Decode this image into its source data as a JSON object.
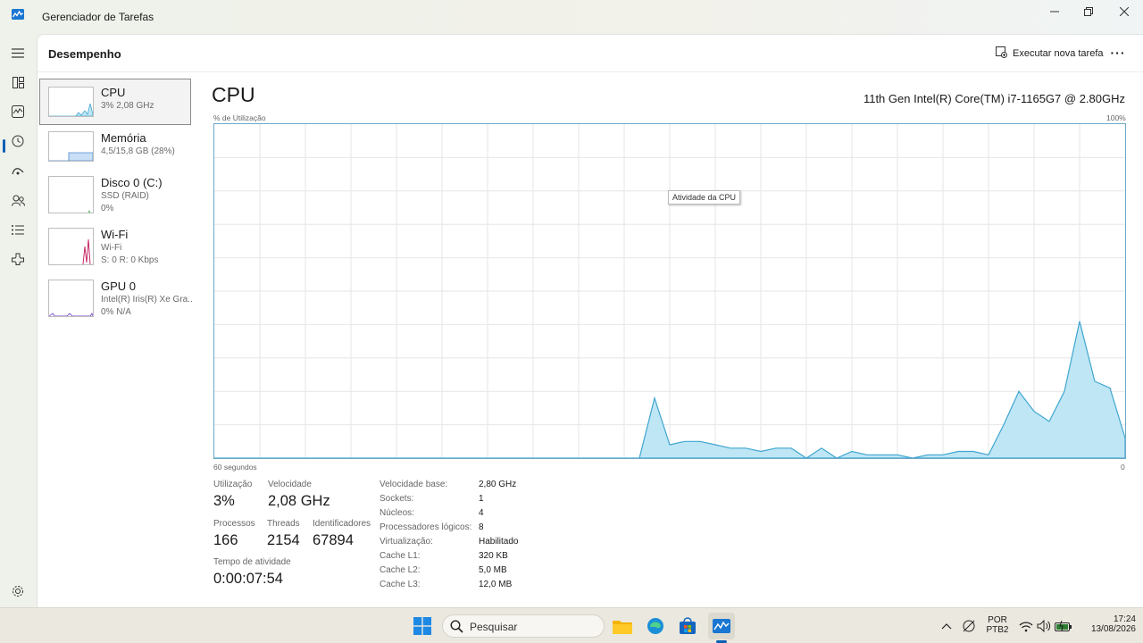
{
  "window": {
    "title": "Gerenciador de Tarefas"
  },
  "header": {
    "section_title": "Desempenho",
    "run_task_label": "Executar nova tarefa",
    "more_label": "···"
  },
  "devices": [
    {
      "name": "CPU",
      "line1": "3%  2,08 GHz",
      "line2": ""
    },
    {
      "name": "Memória",
      "line1": "4,5/15,8 GB (28%)",
      "line2": ""
    },
    {
      "name": "Disco 0 (C:)",
      "line1": "SSD (RAID)",
      "line2": "0%"
    },
    {
      "name": "Wi-Fi",
      "line1": "Wi-Fi",
      "line2": "S: 0 R: 0 Kbps"
    },
    {
      "name": "GPU 0",
      "line1": "Intel(R) Iris(R) Xe Gra...",
      "line2": "0%  N/A"
    }
  ],
  "cpu": {
    "title": "CPU",
    "model": "11th Gen Intel(R) Core(TM) i7-1165G7 @ 2.80GHz",
    "y_label": "% de Utilização",
    "y_max_label": "100%",
    "x_left_label": "60 segundos",
    "x_right_label": "0",
    "tooltip": "Atividade da CPU"
  },
  "chart_data": {
    "type": "area",
    "title": "",
    "xlabel": "",
    "ylabel": "% de Utilização",
    "x": [
      -60,
      -59,
      -58,
      -57,
      -56,
      -55,
      -54,
      -53,
      -52,
      -51,
      -50,
      -49,
      -48,
      -47,
      -46,
      -45,
      -44,
      -43,
      -42,
      -41,
      -40,
      -39,
      -38,
      -37,
      -36,
      -35,
      -34,
      -33,
      -32,
      -31,
      -30,
      -29,
      -28,
      -27,
      -26,
      -25,
      -24,
      -23,
      -22,
      -21,
      -20,
      -19,
      -18,
      -17,
      -16,
      -15,
      -14,
      -13,
      -12,
      -11,
      -10,
      -9,
      -8,
      -7,
      -6,
      -5,
      -4,
      -3,
      -2,
      -1,
      0
    ],
    "values": [
      0,
      0,
      0,
      0,
      0,
      0,
      0,
      0,
      0,
      0,
      0,
      0,
      0,
      0,
      0,
      0,
      0,
      0,
      0,
      0,
      0,
      0,
      0,
      0,
      0,
      0,
      0,
      0,
      0,
      18,
      4,
      5,
      5,
      4,
      3,
      3,
      2,
      3,
      3,
      0,
      3,
      0,
      2,
      1,
      1,
      1,
      0,
      1,
      1,
      2,
      2,
      1,
      10,
      20,
      14,
      11,
      20,
      41,
      23,
      21,
      6,
      2
    ],
    "xlim": [
      -60,
      0
    ],
    "ylim": [
      0,
      100
    ],
    "grid": true,
    "fill_color": "#bfe6f5",
    "line_color": "#3fa6cf"
  },
  "stats": {
    "utilization_label": "Utilização",
    "utilization_value": "3%",
    "speed_label": "Velocidade",
    "speed_value": "2,08 GHz",
    "processes_label": "Processos",
    "processes_value": "166",
    "threads_label": "Threads",
    "threads_value": "2154",
    "handles_label": "Identificadores",
    "handles_value": "67894",
    "uptime_label": "Tempo de atividade",
    "uptime_value": "0:00:07:54"
  },
  "specs": [
    {
      "label": "Velocidade base:",
      "value": "2,80 GHz"
    },
    {
      "label": "Sockets:",
      "value": "1"
    },
    {
      "label": "Núcleos:",
      "value": "4"
    },
    {
      "label": "Processadores lógicos:",
      "value": "8"
    },
    {
      "label": "Virtualização:",
      "value": "Habilitado"
    },
    {
      "label": "Cache L1:",
      "value": "320 KB"
    },
    {
      "label": "Cache L2:",
      "value": "5,0 MB"
    },
    {
      "label": "Cache L3:",
      "value": "12,0 MB"
    }
  ],
  "taskbar": {
    "search_placeholder": "Pesquisar",
    "language_line1": "POR",
    "language_line2": "PTB2",
    "time": "17:24",
    "date": "13/08/2026"
  },
  "colors": {
    "accent": "#0a5fb4",
    "graph_border": "#6ea9c9",
    "grid": "#e6e6e6"
  }
}
